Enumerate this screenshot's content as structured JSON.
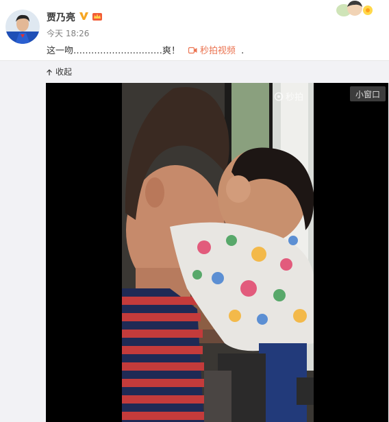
{
  "post": {
    "author": "贾乃亮",
    "time_label": "今天 18:26",
    "text": "这一吻…………………………爽！",
    "video_link_label": "秒拍视频",
    "trailing": "."
  },
  "media": {
    "collapse_label": "收起",
    "watermark": "秒拍",
    "mini_window_label": "小窗口"
  },
  "icons": {
    "verified": "verified-v-icon",
    "member": "member-crown-icon",
    "video": "video-camera-icon",
    "collapse": "arrow-up-icon"
  },
  "colors": {
    "link": "#eb7350",
    "verified": "#f6a623",
    "section_bg": "#f2f2f5",
    "player_bg": "#000000"
  }
}
